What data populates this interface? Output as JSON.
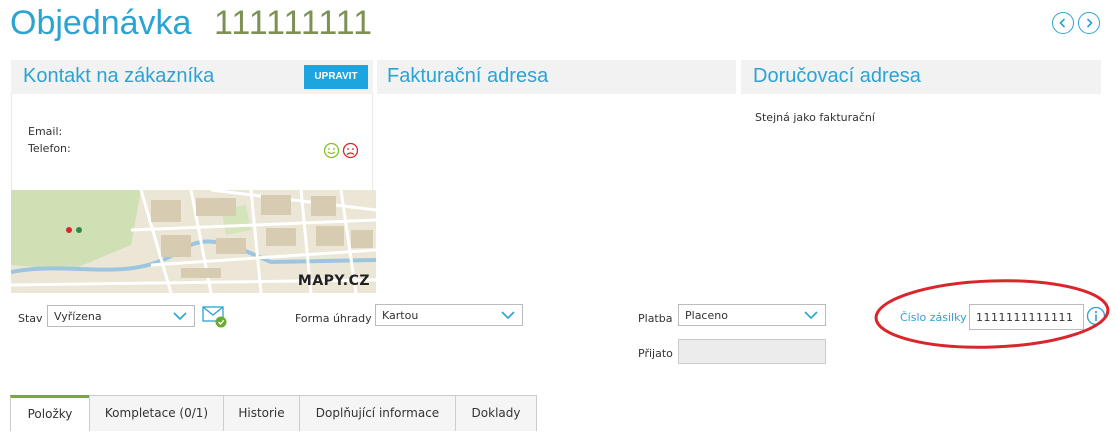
{
  "header": {
    "title": "Objednávka",
    "order_number": "111111111",
    "prev_icon": "chevron-left-icon",
    "next_icon": "chevron-right-icon"
  },
  "contact": {
    "heading": "Kontakt na zákazníka",
    "edit_label": "UPRAVIT",
    "email_label": "Email:",
    "phone_label": "Telefon:",
    "map_logo": "MAPY.CZ"
  },
  "billing": {
    "heading": "Fakturační adresa"
  },
  "delivery": {
    "heading": "Doručovací adresa",
    "text": "Stejná jako fakturační"
  },
  "form": {
    "status_label": "Stav",
    "status_value": "Vyřízena",
    "payment_method_label": "Forma úhrady",
    "payment_method_value": "Kartou",
    "payment_label": "Platba",
    "payment_value": "Placeno",
    "received_label": "Přijato",
    "received_value": "",
    "shipment_label": "Číslo zásilky",
    "shipment_value": "1111111111111"
  },
  "tabs": [
    {
      "label": "Položky",
      "active": true
    },
    {
      "label": "Kompletace (0/1)",
      "active": false
    },
    {
      "label": "Historie",
      "active": false
    },
    {
      "label": "Doplňující informace",
      "active": false
    },
    {
      "label": "Doklady",
      "active": false
    }
  ],
  "colors": {
    "accent": "#2ba3d3",
    "order_number": "#7d9152",
    "highlight_ring": "#d9262c",
    "active_tab": "#7aa83a"
  }
}
